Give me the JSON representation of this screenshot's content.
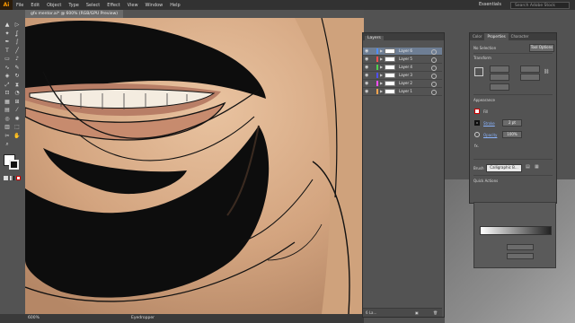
{
  "app": {
    "logo": "Ai",
    "menus": [
      "File",
      "Edit",
      "Object",
      "Type",
      "Select",
      "Effect",
      "View",
      "Window",
      "Help"
    ],
    "workspace": "Essentials",
    "search_placeholder": "Search Adobe Stock"
  },
  "document": {
    "tab_title": "gfx mentor.ai* @ 600% (RGB/GPU Preview)",
    "zoom": "600%",
    "status_tool": "Eyedropper"
  },
  "layers_panel": {
    "tab": "Layers",
    "layers": [
      {
        "name": "Layer 6",
        "color": "#4f8fff",
        "selected": true
      },
      {
        "name": "Layer 5",
        "color": "#ff4f4f",
        "selected": false
      },
      {
        "name": "Layer 4",
        "color": "#4fd04f",
        "selected": false
      },
      {
        "name": "Layer 3",
        "color": "#4f4fff",
        "selected": false
      },
      {
        "name": "Layer 2",
        "color": "#ff4fff",
        "selected": false
      },
      {
        "name": "Layer 1",
        "color": "#ffa54f",
        "selected": false
      }
    ],
    "footer_count": "6 La..."
  },
  "properties_panel": {
    "tabs": [
      "Color",
      "Properties",
      "Character"
    ],
    "selection": "No Selection",
    "tool_options": "Tool Options",
    "transform": "Transform",
    "appearance": "Appearance",
    "fill": "Fill",
    "stroke": "Stroke",
    "stroke_weight": "2 pt",
    "opacity": "Opacity",
    "opacity_value": "100%",
    "fx": "fx.",
    "brush_label": "Brush",
    "brush_value": "Calligraphic B...",
    "quick_actions": "Quick Actions"
  },
  "tools": [
    "select-icon",
    "direct-select-icon",
    "magic-wand-icon",
    "lasso-icon",
    "pen-icon",
    "curvature-icon",
    "type-icon",
    "line-icon",
    "rectangle-icon",
    "paintbrush-icon",
    "shaper-icon",
    "pencil-icon",
    "eraser-icon",
    "rotate-icon",
    "scale-icon",
    "width-icon",
    "free-transform-icon",
    "shape-builder-icon",
    "perspective-icon",
    "mesh-icon",
    "gradient-icon",
    "eyedropper-icon",
    "blend-icon",
    "symbol-sprayer-icon",
    "column-graph-icon",
    "artboard-icon",
    "slice-icon",
    "hand-icon",
    "zoom-icon"
  ],
  "tool_glyphs": [
    "▲",
    "▷",
    "✦",
    "ʆ",
    "✒",
    "∫",
    "T",
    "╱",
    "▭",
    "♪",
    "∿",
    "✎",
    "◈",
    "↻",
    "⤢",
    "⧗",
    "⊡",
    "◔",
    "▦",
    "⊞",
    "▤",
    "⁄",
    "◎",
    "✺",
    "▥",
    "⬚",
    "✂",
    "✋",
    "⌕"
  ]
}
